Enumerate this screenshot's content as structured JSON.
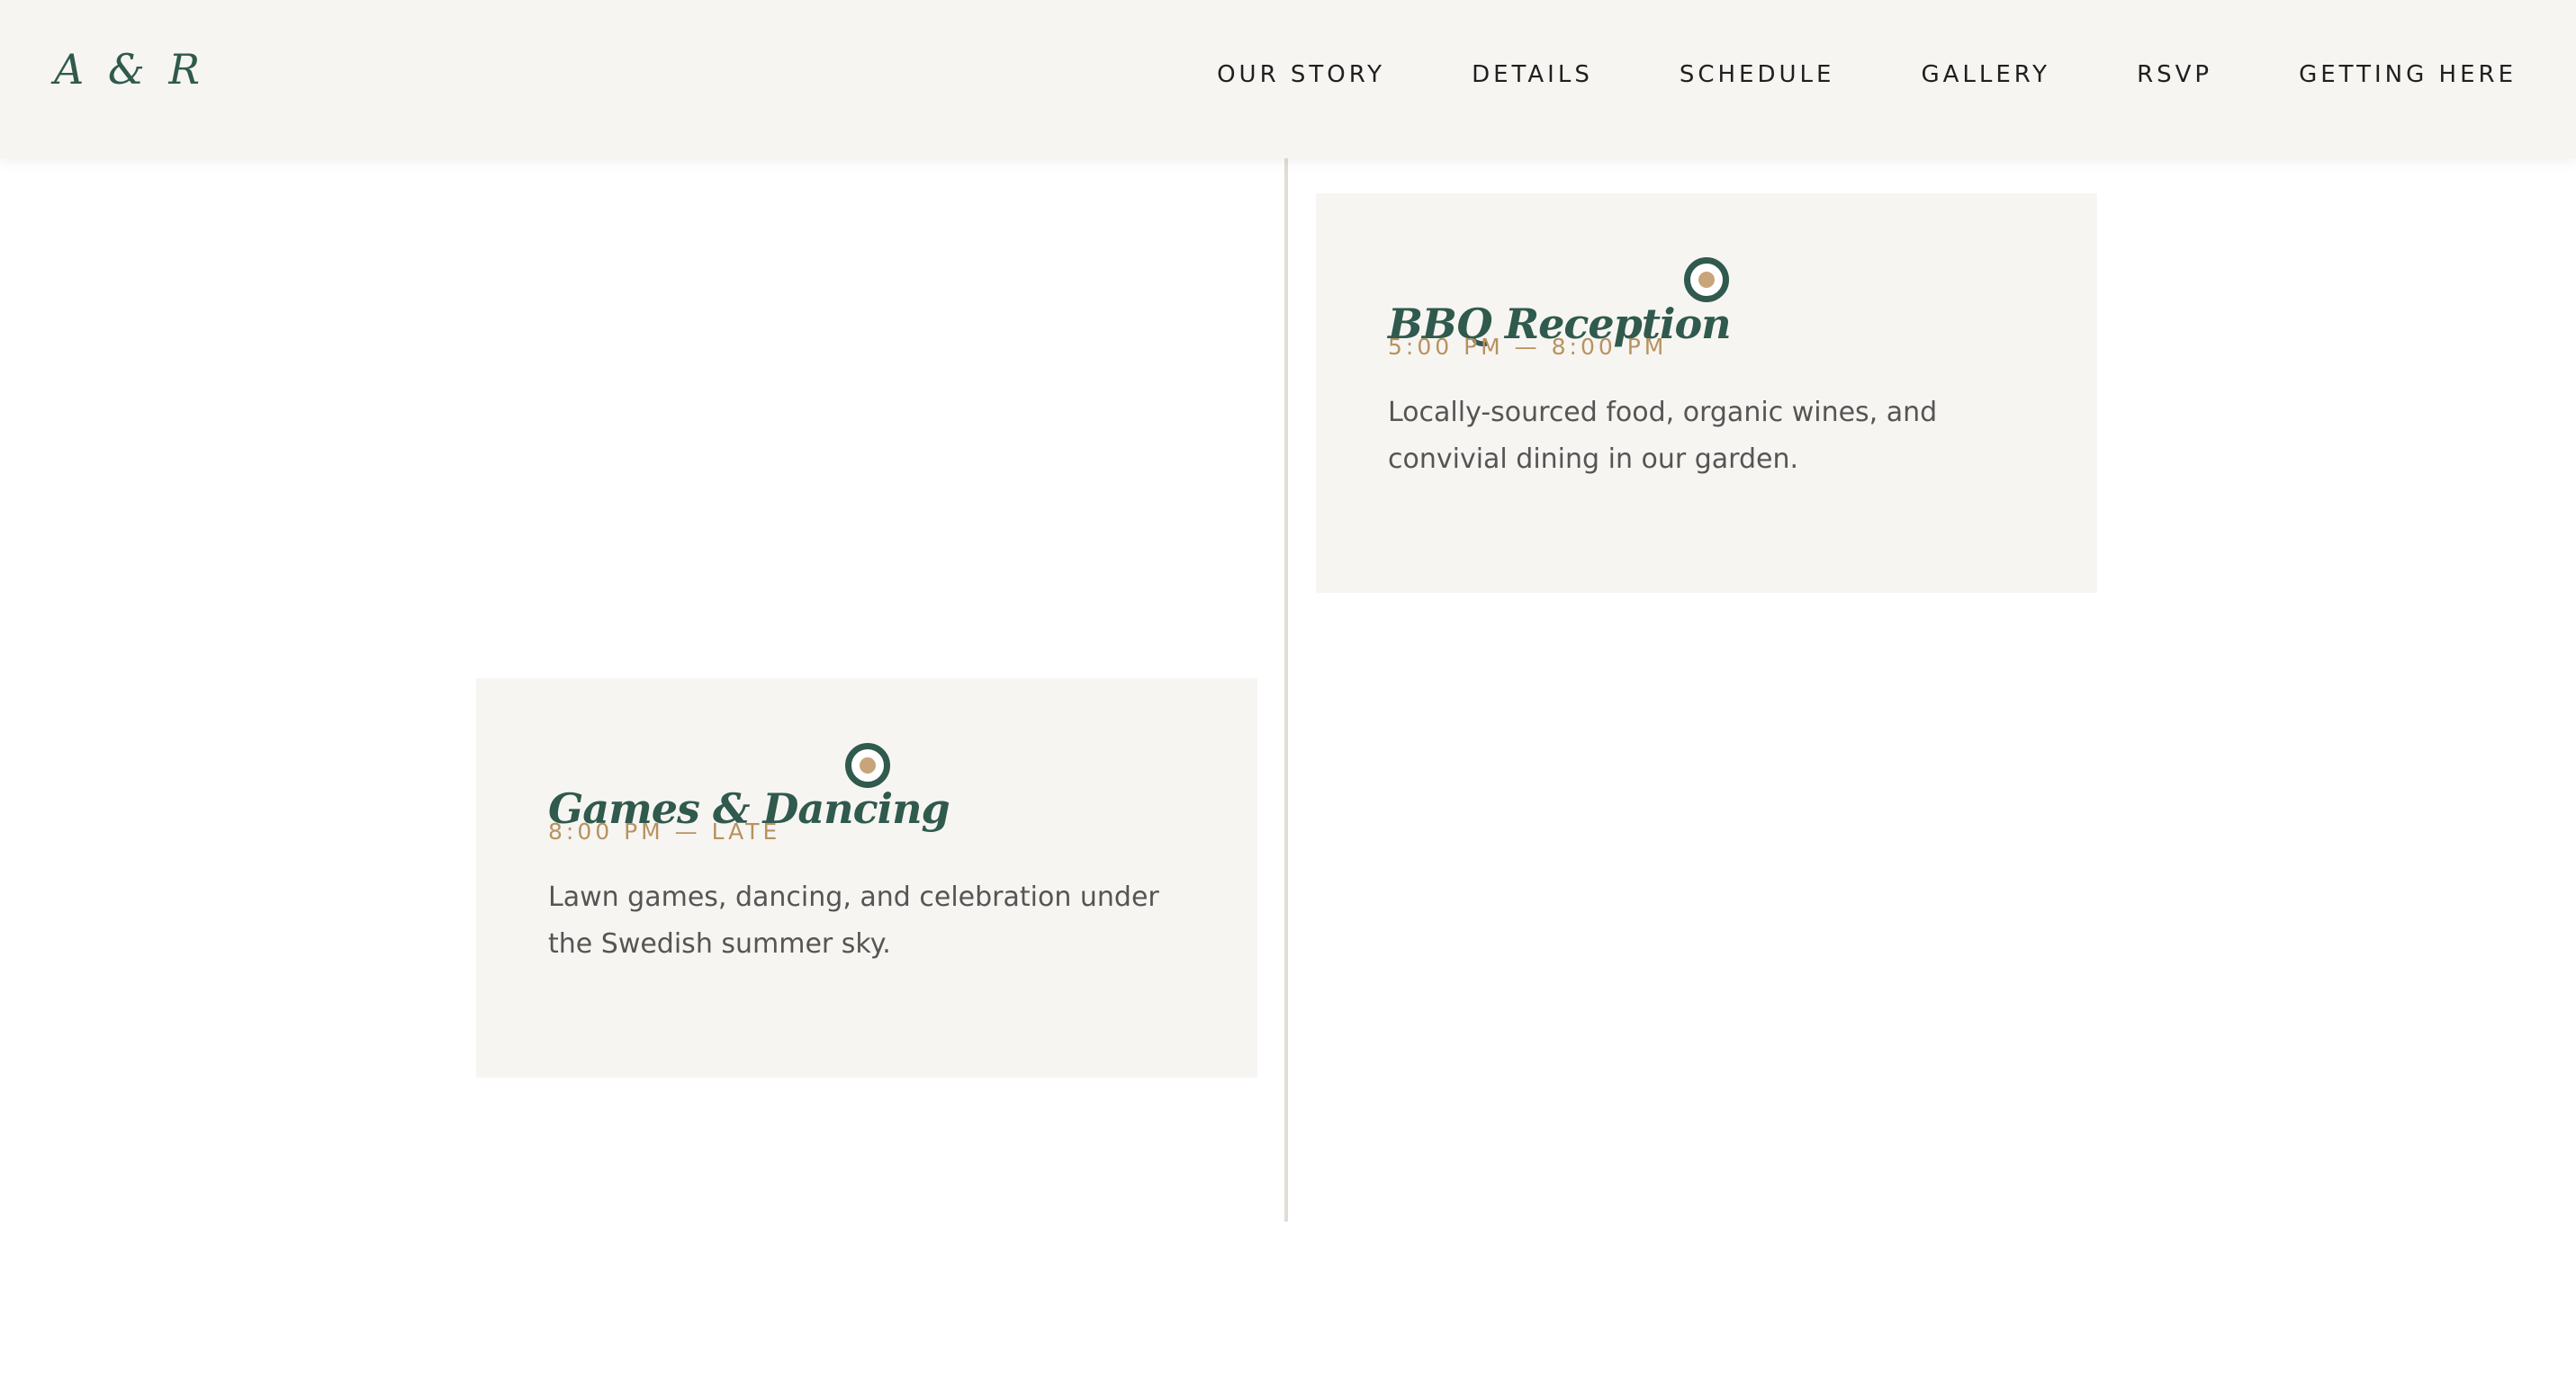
{
  "header": {
    "logo": "A & R",
    "nav": [
      {
        "label": "OUR STORY"
      },
      {
        "label": "DETAILS"
      },
      {
        "label": "SCHEDULE"
      },
      {
        "label": "GALLERY"
      },
      {
        "label": "RSVP"
      },
      {
        "label": "GETTING HERE"
      }
    ]
  },
  "schedule": {
    "events": [
      {
        "title": "BBQ Reception",
        "time": "5:00 PM — 8:00 PM",
        "description": "Locally-sourced food, organic wines, and convivial dining in our garden."
      },
      {
        "title": "Games & Dancing",
        "time": "8:00 PM — LATE",
        "description": "Lawn games, dancing, and celebration under the Swedish summer sky."
      }
    ]
  },
  "colors": {
    "accent": "#2f5a4d",
    "gold": "#b8925f",
    "card_bg": "#f7f5f2",
    "header_bg": "#f7f5f2",
    "line": "#e2ddd3"
  },
  "icons": {
    "timeline_marker": "timeline-dot-icon"
  }
}
